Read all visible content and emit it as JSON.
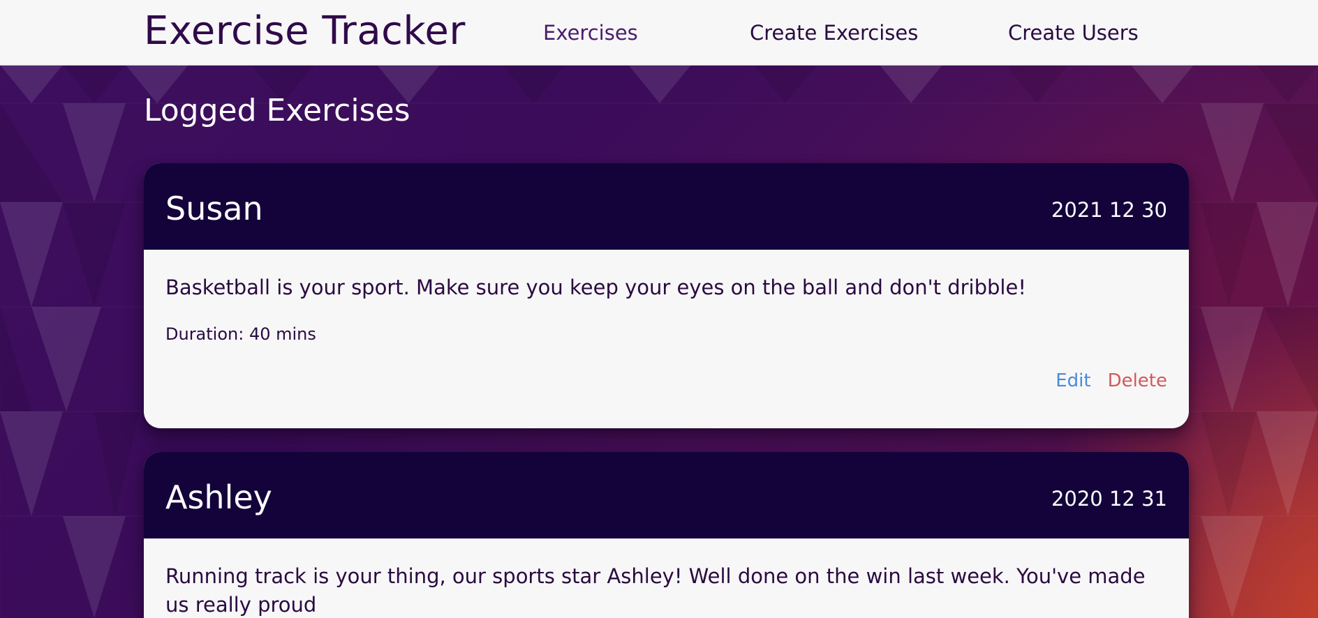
{
  "app": {
    "title": "Exercise Tracker"
  },
  "nav": {
    "items": [
      {
        "label": "Exercises",
        "active": true
      },
      {
        "label": "Create Exercises",
        "active": false
      },
      {
        "label": "Create Users",
        "active": false
      }
    ]
  },
  "main": {
    "heading": "Logged Exercises",
    "exercises": [
      {
        "username": "Susan",
        "date": "2021 12 30",
        "description": "Basketball is your sport. Make sure you keep your eyes on the ball and don't dribble!",
        "duration": "Duration: 40 mins",
        "edit_label": "Edit",
        "delete_label": "Delete"
      },
      {
        "username": "Ashley",
        "date": "2020 12 31",
        "description": "Running track is your thing, our sports star Ashley! Well done on the win last week. You've made us really proud"
      }
    ]
  },
  "colors": {
    "navbar_bg": "#f7f7f8",
    "brand_text": "#300a4a",
    "card_header_bg": "#13033a",
    "card_body_bg": "#f7f7f8",
    "edit_link": "#4a8ad8",
    "delete_link": "#d45858"
  }
}
